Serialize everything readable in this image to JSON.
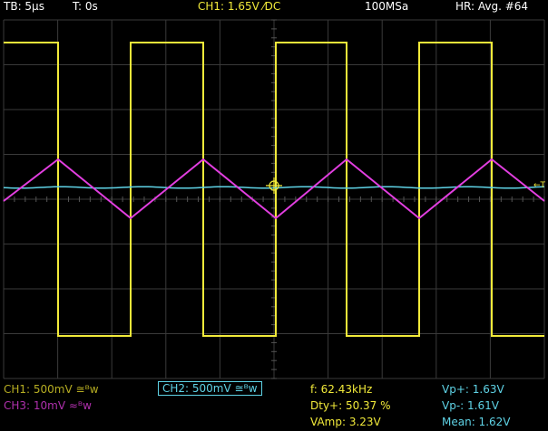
{
  "header": {
    "timebase": "TB: 5µs",
    "trigger_time": "T: 0s",
    "trigger": "CH1: 1.65V ⁄DC",
    "sample_rate": "100MSa",
    "acquisition": "HR: Avg. #64"
  },
  "channels": {
    "ch1": "CH1: 500mV ≅ᴮw",
    "ch2": "CH2: 500mV ≅ᴮw",
    "ch3": "CH3: 10mV ≈ᴮw"
  },
  "measurements": {
    "frequency": "f: 62.43kHz",
    "duty": "Dty+: 50.37 %",
    "vamp": "VAmp: 3.23V",
    "vp_plus": "Vp+: 1.63V",
    "vp_minus": "Vp-: 1.61V",
    "mean": "Mean: 1.62V"
  },
  "trigger_marker": "←T",
  "colors": {
    "ch1": "#f2ea3a",
    "ch2": "#5fd3e6",
    "ch3": "#e23ee0",
    "grid": "#3a3a3a",
    "text": "#ffffff"
  }
}
